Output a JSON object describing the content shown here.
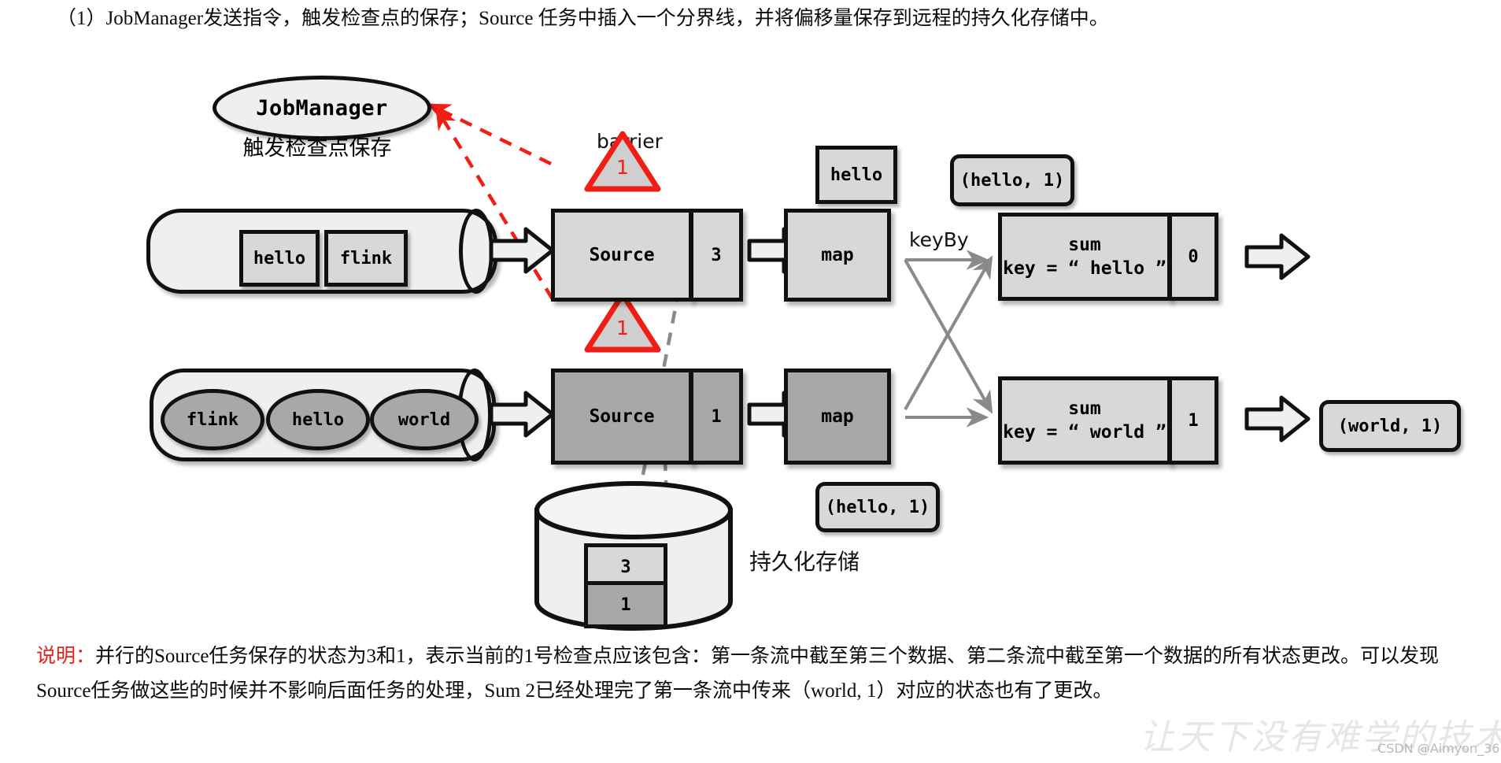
{
  "intro": {
    "text": "（1）JobManager发送指令，触发检查点的保存；Source 任务中插入一个分界线，并将偏移量保存到远程的持久化存储中。"
  },
  "diagram": {
    "jobmanager": {
      "label": "JobManager",
      "caption": "触发检查点保存"
    },
    "barrier_label": "barrier",
    "barriers": [
      {
        "id": "barrier-stream-1",
        "value": "1"
      },
      {
        "id": "barrier-stream-2",
        "value": "1"
      }
    ],
    "stream1": {
      "tokens": [
        "hello",
        "flink"
      ],
      "source": {
        "label": "Source",
        "state": "3"
      },
      "map": {
        "label": "map"
      },
      "emitted": "hello",
      "sum": {
        "title": "sum",
        "key": "key = “ hello ”",
        "state": "0"
      },
      "output": "(hello, 1)"
    },
    "stream2": {
      "tokens": [
        "flink",
        "hello",
        "world"
      ],
      "source": {
        "label": "Source",
        "state": "1"
      },
      "map": {
        "label": "map"
      },
      "emitted": "(hello, 1)",
      "sum": {
        "title": "sum",
        "key": "key = “ world ”",
        "state": "1"
      },
      "output": "(world, 1)"
    },
    "keyby_label": "keyBy",
    "storage": {
      "caption": "持久化存储",
      "saved": [
        "3",
        "1"
      ]
    },
    "colors": {
      "barrier_red": "#f01e14",
      "stroke": "#111111",
      "fill_light": "#efefef",
      "fill_mid": "#d8d8d8",
      "fill_dark": "#a8a8a8",
      "dashed_gray": "#8a8a8a"
    }
  },
  "note": {
    "label": "说明：",
    "body": "并行的Source任务保存的状态为3和1，表示当前的1号检查点应该包含：第一条流中截至第三个数据、第二条流中截至第一个数据的所有状态更改。可以发现Source任务做这些的时候并不影响后面任务的处理，Sum 2已经处理完了第一条流中传来（world, 1）对应的状态也有了更改。"
  },
  "watermark": {
    "text": "让天下没有难学的技术",
    "credit": "CSDN @Aimyon_36"
  }
}
